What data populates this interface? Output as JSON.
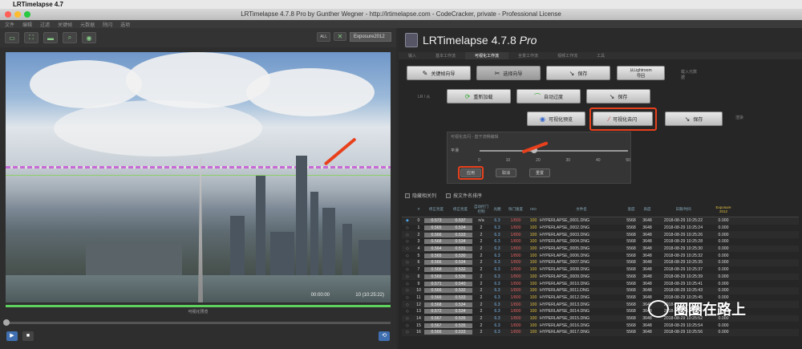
{
  "menubar": {
    "app_name": "LRTimelapse 4.7"
  },
  "window_title": "LRTimelapse 4.7.8 Pro by Gunther Wegner - http://lrtimelapse.com - CodeCracker, private - Professional License",
  "window_menu": [
    "文件",
    "编辑",
    "过滤",
    "关键帧",
    "元数据",
    "除闪",
    "选项"
  ],
  "left_toolbar": {
    "all_label": "ALL",
    "select_value": "Exposure2012"
  },
  "preview": {
    "time_left": "00:00:00",
    "time_right": "10 (10:25:22)",
    "label": "可视化预览"
  },
  "right_header": {
    "title": "LRTimelapse 4.7.8",
    "title_pro": "Pro"
  },
  "tabs": [
    "输入",
    "基本工作流",
    "可视化工作流",
    "全景工作流",
    "视频工作流",
    "工具"
  ],
  "workflow": {
    "keyframe_wizard": "关键帧向导",
    "select_wizard": "选择向导",
    "save1": "保存",
    "from_lightroom": "从Lightroom",
    "from_lightroom_2": "导回",
    "lr_label": "LR",
    "load_metadata": "载入元数据",
    "reload": "重新加载",
    "auto_transition": "自动过度",
    "save2": "保存",
    "visual_preview": "可视化预览",
    "visual_deflicker": "可视化去闪",
    "save3": "保存",
    "deflicker_render": "渲染此帧",
    "side_label_1": "LR / 从",
    "side_label_2": "渲染"
  },
  "deflicker_panel": {
    "title": "可视化去闪 - 基于流畅编辑",
    "smooth_label": "平滑",
    "ticks": [
      "0",
      "10",
      "20",
      "30",
      "40",
      "50"
    ],
    "apply": "应用",
    "cancel": "取消",
    "reset": "重置"
  },
  "checks": {
    "hide_cols": "隐藏相关列",
    "by_filename": "按文件名排序"
  },
  "table": {
    "headers": [
      "",
      "#",
      "修正亮度",
      "修正亮度",
      "自动控门控制",
      "光圈",
      "快门速度",
      "ISO",
      "文件名",
      "宽度",
      "高度",
      "日期/时间",
      "Exposure 2012"
    ],
    "rows": [
      [
        "0",
        "0.573",
        "0.537",
        "n/a",
        "6.3",
        "1/800",
        "100",
        "HYPERLAPSE_0001.DNG",
        "5568",
        "3648",
        "2018-08-29 10:25:22",
        "0.000"
      ],
      [
        "1",
        "0.565",
        "0.534",
        "2",
        "6.3",
        "1/800",
        "100",
        "HYPERLAPSE_0002.DNG",
        "5568",
        "3648",
        "2018-08-29 10:25:24",
        "0.000"
      ],
      [
        "2",
        "0.566",
        "0.533",
        "2",
        "6.3",
        "1/800",
        "100",
        "HYPERLAPSE_0003.DNG",
        "5568",
        "3648",
        "2018-08-29 10:25:26",
        "0.000"
      ],
      [
        "3",
        "0.568",
        "0.534",
        "2",
        "6.3",
        "1/800",
        "100",
        "HYPERLAPSE_0004.DNG",
        "5568",
        "3648",
        "2018-08-29 10:25:28",
        "0.000"
      ],
      [
        "4",
        "0.564",
        "0.531",
        "2",
        "6.3",
        "1/800",
        "100",
        "HYPERLAPSE_0005.DNG",
        "5568",
        "3648",
        "2018-08-29 10:25:30",
        "0.000"
      ],
      [
        "5",
        "0.565",
        "0.530",
        "2",
        "6.3",
        "1/800",
        "100",
        "HYPERLAPSE_0006.DNG",
        "5568",
        "3648",
        "2018-08-29 10:25:32",
        "0.000"
      ],
      [
        "6",
        "0.566",
        "0.534",
        "2",
        "6.3",
        "1/800",
        "100",
        "HYPERLAPSE_0007.DNG",
        "5568",
        "3648",
        "2018-08-29 10:25:35",
        "0.000"
      ],
      [
        "7",
        "0.568",
        "0.532",
        "2",
        "6.3",
        "1/800",
        "100",
        "HYPERLAPSE_0008.DNG",
        "5568",
        "3648",
        "2018-08-29 10:25:37",
        "0.000"
      ],
      [
        "8",
        "0.569",
        "0.536",
        "2",
        "6.3",
        "1/800",
        "100",
        "HYPERLAPSE_0009.DNG",
        "5568",
        "3648",
        "2018-08-29 10:25:39",
        "0.000"
      ],
      [
        "9",
        "0.571",
        "0.540",
        "2",
        "6.3",
        "1/800",
        "100",
        "HYPERLAPSE_0010.DNG",
        "5568",
        "3648",
        "2018-08-29 10:25:41",
        "0.000"
      ],
      [
        "10",
        "0.566",
        "0.532",
        "2",
        "6.3",
        "1/800",
        "100",
        "HYPERLAPSE_0011.DNG",
        "5568",
        "3648",
        "2018-08-29 10:25:43",
        "0.000"
      ],
      [
        "11",
        "0.566",
        "0.533",
        "2",
        "6.3",
        "1/800",
        "100",
        "HYPERLAPSE_0012.DNG",
        "5568",
        "3648",
        "2018-08-29 10:25:45",
        "0.000"
      ],
      [
        "12",
        "0.568",
        "0.534",
        "2",
        "6.3",
        "1/800",
        "100",
        "HYPERLAPSE_0013.DNG",
        "5568",
        "3648",
        "2018-08-29 10:25:48",
        "0.000"
      ],
      [
        "13",
        "0.572",
        "0.534",
        "2",
        "6.3",
        "1/800",
        "100",
        "HYPERLAPSE_0014.DNG",
        "5568",
        "3648",
        "2018-08-29 10:25:50",
        "0.000"
      ],
      [
        "14",
        "0.567",
        "0.535",
        "2",
        "6.3",
        "1/800",
        "100",
        "HYPERLAPSE_0015.DNG",
        "5568",
        "3648",
        "2018-08-29 10:25:52",
        "0.000"
      ],
      [
        "15",
        "0.567",
        "0.535",
        "2",
        "6.3",
        "1/800",
        "100",
        "HYPERLAPSE_0016.DNG",
        "5568",
        "3648",
        "2018-08-29 10:25:54",
        "0.000"
      ],
      [
        "16",
        "0.566",
        "0.533",
        "2",
        "6.3",
        "1/800",
        "100",
        "HYPERLAPSE_0017.DNG",
        "5568",
        "3648",
        "2018-08-29 10:25:56",
        "0.000"
      ]
    ]
  },
  "watermark": "圈圈在路上",
  "colors": {
    "highlight": "#e8401c",
    "accent_green": "#5ed15e"
  }
}
